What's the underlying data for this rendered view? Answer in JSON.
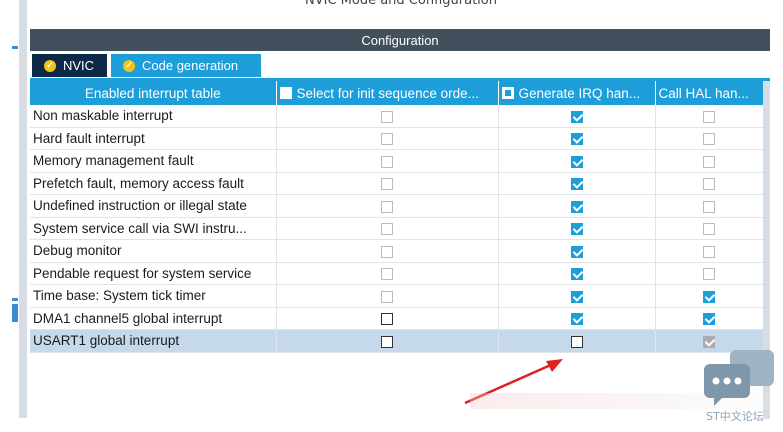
{
  "window": {
    "title": "NVIC Mode and Configuration",
    "panel_title": "Configuration"
  },
  "tabs": [
    {
      "label": "NVIC",
      "active": false
    },
    {
      "label": "Code generation",
      "active": true
    }
  ],
  "table": {
    "headers": {
      "name": "Enabled interrupt table",
      "init_seq": "Select for init sequence orde...",
      "gen_irq": "Generate IRQ han...",
      "call_hal": "Call HAL han..."
    },
    "rows": [
      {
        "name": "Non maskable interrupt",
        "init_seq": false,
        "init_seq_enabled": false,
        "gen_irq": true,
        "gen_irq_enabled": true,
        "call_hal": false,
        "call_hal_enabled": false
      },
      {
        "name": "Hard fault interrupt",
        "init_seq": false,
        "init_seq_enabled": false,
        "gen_irq": true,
        "gen_irq_enabled": true,
        "call_hal": false,
        "call_hal_enabled": false
      },
      {
        "name": "Memory management fault",
        "init_seq": false,
        "init_seq_enabled": false,
        "gen_irq": true,
        "gen_irq_enabled": true,
        "call_hal": false,
        "call_hal_enabled": false
      },
      {
        "name": "Prefetch fault, memory access fault",
        "init_seq": false,
        "init_seq_enabled": false,
        "gen_irq": true,
        "gen_irq_enabled": true,
        "call_hal": false,
        "call_hal_enabled": false
      },
      {
        "name": "Undefined instruction or illegal state",
        "init_seq": false,
        "init_seq_enabled": false,
        "gen_irq": true,
        "gen_irq_enabled": true,
        "call_hal": false,
        "call_hal_enabled": false
      },
      {
        "name": "System service call via SWI instru...",
        "init_seq": false,
        "init_seq_enabled": false,
        "gen_irq": true,
        "gen_irq_enabled": true,
        "call_hal": false,
        "call_hal_enabled": false
      },
      {
        "name": "Debug monitor",
        "init_seq": false,
        "init_seq_enabled": false,
        "gen_irq": true,
        "gen_irq_enabled": true,
        "call_hal": false,
        "call_hal_enabled": false
      },
      {
        "name": "Pendable request for system service",
        "init_seq": false,
        "init_seq_enabled": false,
        "gen_irq": true,
        "gen_irq_enabled": true,
        "call_hal": false,
        "call_hal_enabled": false
      },
      {
        "name": "Time base: System tick timer",
        "init_seq": false,
        "init_seq_enabled": false,
        "gen_irq": true,
        "gen_irq_enabled": true,
        "call_hal": true,
        "call_hal_enabled": true
      },
      {
        "name": "DMA1 channel5 global interrupt",
        "init_seq": false,
        "init_seq_enabled": true,
        "gen_irq": true,
        "gen_irq_enabled": true,
        "call_hal": true,
        "call_hal_enabled": true
      },
      {
        "name": "USART1 global interrupt",
        "init_seq": false,
        "init_seq_enabled": true,
        "gen_irq": false,
        "gen_irq_enabled": true,
        "call_hal": true,
        "call_hal_enabled": false,
        "selected": true
      }
    ]
  },
  "watermark": {
    "text": "ST中文论坛"
  },
  "colors": {
    "accent": "#1e9ed9",
    "header_bar": "#424f5c",
    "inactive_tab": "#0c2a48",
    "ok_icon": "#f3c316",
    "selected_row": "#c6d9ea",
    "annotation_arrow": "#e02020"
  },
  "icons": {
    "tab_status": "check-circle-icon",
    "header_checkbox": "checkbox-icon"
  }
}
